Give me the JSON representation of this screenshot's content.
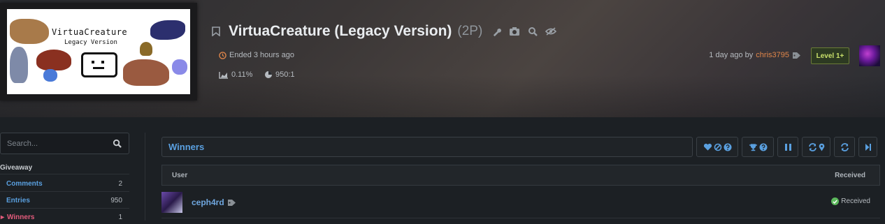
{
  "header": {
    "thumbnail": {
      "title": "VirtuaCreature",
      "subtitle": "Legacy Version"
    },
    "title": "VirtuaCreature (Legacy Version)",
    "points": "(2P)",
    "title_icons": [
      "wrench-icon",
      "camera-icon",
      "magnifier-icon",
      "eye-slash-icon"
    ],
    "ended": "Ended 3 hours ago",
    "chance": "0.11%",
    "ratio": "950:1",
    "created": "1 day ago by",
    "creator": "chris3795",
    "level": "Level 1+"
  },
  "sidebar": {
    "search_placeholder": "Search...",
    "heading": "Giveaway",
    "items": [
      {
        "label": "Comments",
        "count": "2"
      },
      {
        "label": "Entries",
        "count": "950"
      },
      {
        "label": "Winners",
        "count": "1"
      }
    ]
  },
  "main": {
    "section_title": "Winners",
    "toolbar_icons": [
      "heart-icon",
      "ban-icon",
      "question-icon",
      "trophy-icon",
      "question-icon",
      "pause-icon",
      "sync-pin-icon",
      "refresh-icon",
      "skip-icon"
    ],
    "columns": {
      "user": "User",
      "received": "Received"
    },
    "rows": [
      {
        "user": "ceph4rd",
        "status": "Received"
      }
    ]
  },
  "colors": {
    "accent_blue": "#5aa0e0",
    "creator_orange": "#e0864a",
    "winners_pink": "#e35b7c",
    "level_green": "#c9e06a",
    "received_green": "#5cb85c"
  }
}
